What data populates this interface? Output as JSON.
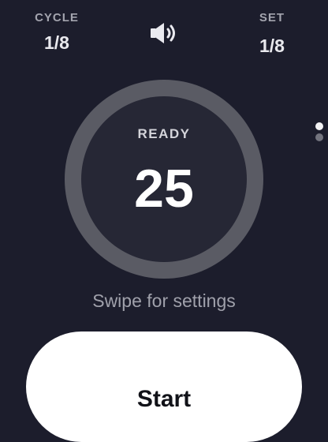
{
  "cycle": {
    "label": "CYCLE",
    "value": "1/8"
  },
  "set": {
    "label": "SET",
    "value": "1/8"
  },
  "sound_icon": "speaker-volume-icon",
  "timer": {
    "status": "READY",
    "count": "25"
  },
  "pager": {
    "pages": 2,
    "active": 1
  },
  "hint": "Swipe for settings",
  "start_button": {
    "label": "Start"
  },
  "colors": {
    "background": "#1c1d2c",
    "ring_outer": "#5a5b64",
    "ring_inner": "#262735",
    "button": "#ffffff"
  }
}
